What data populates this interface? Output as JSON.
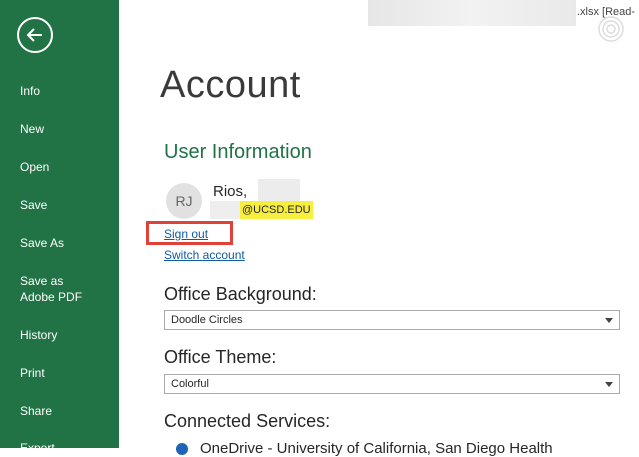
{
  "titlebar": {
    "filename_suffix": ".xlsx  [Read-"
  },
  "sidebar": {
    "items": [
      {
        "label": "Info"
      },
      {
        "label": "New"
      },
      {
        "label": "Open"
      },
      {
        "label": "Save"
      },
      {
        "label": "Save As"
      },
      {
        "label": "Save as Adobe PDF"
      },
      {
        "label": "History"
      },
      {
        "label": "Print"
      },
      {
        "label": "Share"
      },
      {
        "label": "Export"
      }
    ]
  },
  "main": {
    "title": "Account",
    "user_info": {
      "heading": "User Information",
      "initials": "RJ",
      "name": "Rios,",
      "email_domain": "@UCSD.EDU",
      "sign_out": "Sign out",
      "switch_account": "Switch account"
    },
    "office_background": {
      "label": "Office Background:",
      "value": "Doodle Circles"
    },
    "office_theme": {
      "label": "Office Theme:",
      "value": "Colorful"
    },
    "connected_services": {
      "label": "Connected Services:",
      "first_service": "OneDrive - University of California, San Diego Health"
    }
  },
  "colors": {
    "sidebar_bg": "#217346",
    "accent_green": "#217346",
    "link_blue": "#0f5b9e",
    "highlight_red": "#e0423a",
    "email_highlight": "#f7ee3f"
  }
}
